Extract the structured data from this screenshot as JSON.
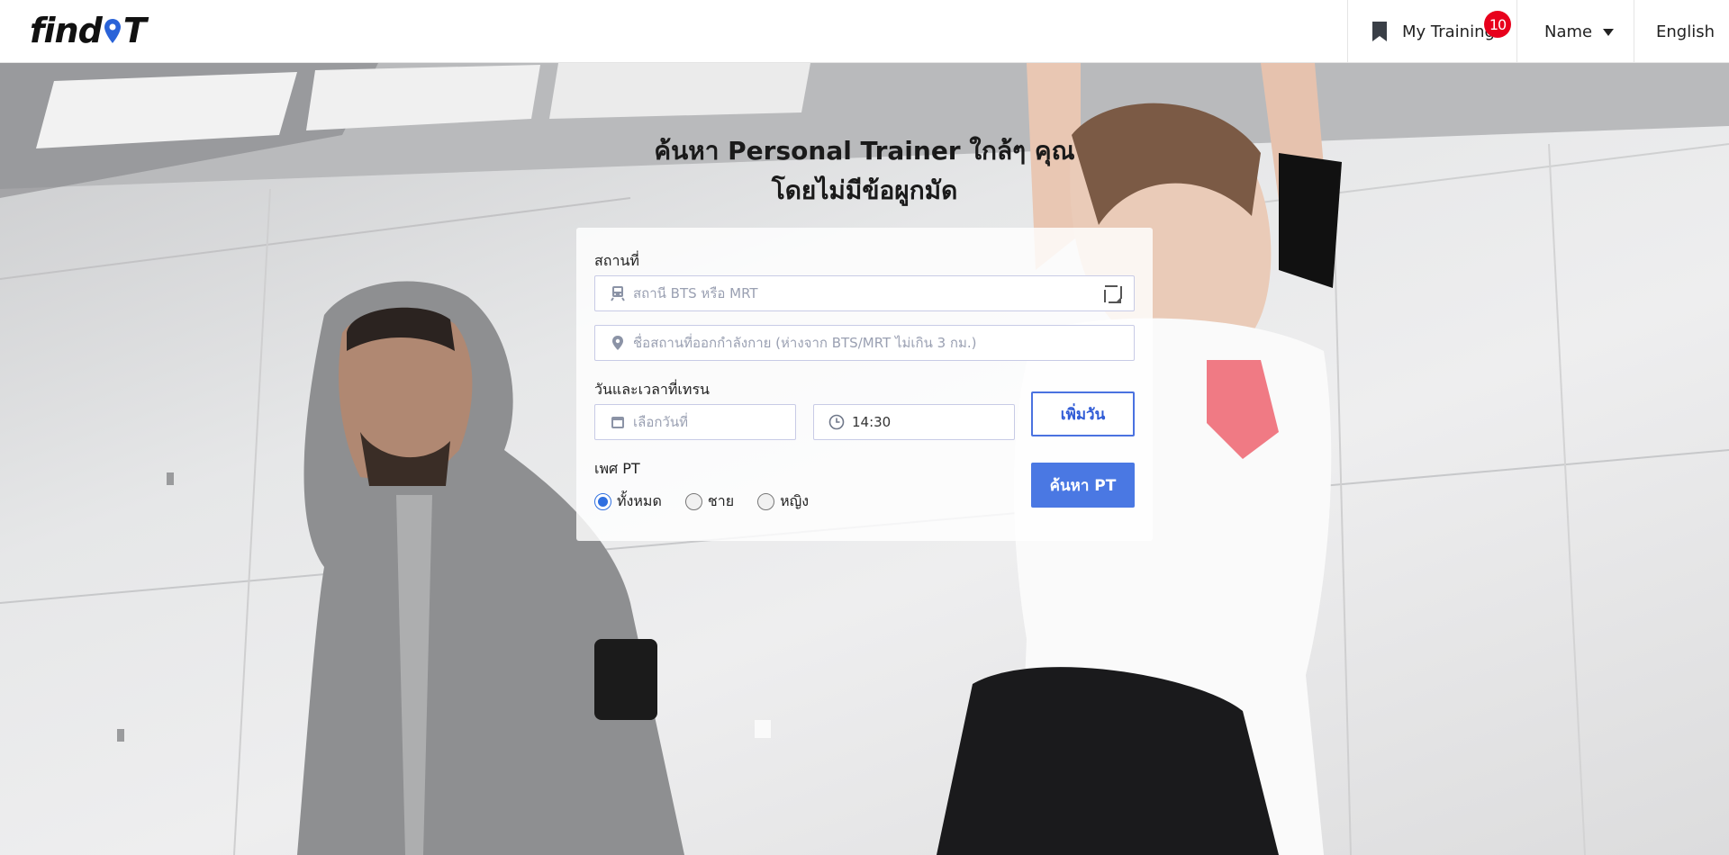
{
  "header": {
    "logo": "findPT",
    "my_training": "My Training",
    "badge": "10",
    "name_menu": "Name",
    "language": "English"
  },
  "hero": {
    "title_line1": "ค้นหา Personal Trainer ใกล้ๆ คุณ",
    "title_line2": "โดยไม่มีข้อผูกมัด"
  },
  "form": {
    "location_label": "สถานที่",
    "station_placeholder": "สถานี BTS หรือ MRT",
    "gym_placeholder": "ชื่อสถานที่ออกกำลังกาย (ห่างจาก BTS/MRT ไม่เกิน 3 กม.)",
    "datetime_label": "วันและเวลาที่เทรน",
    "date_placeholder": "เลือกวันที่",
    "time_value": "14:30",
    "add_day_button": "เพิ่มวัน",
    "gender_label": "เพศ PT",
    "gender_options": [
      "ทั้งหมด",
      "ชาย",
      "หญิง"
    ],
    "selected_gender": "ทั้งหมด",
    "search_button": "ค้นหา PT"
  },
  "colors": {
    "accent": "#4a78e3",
    "badge": "#e8001c",
    "radio_selected": "#2f6fe0"
  }
}
